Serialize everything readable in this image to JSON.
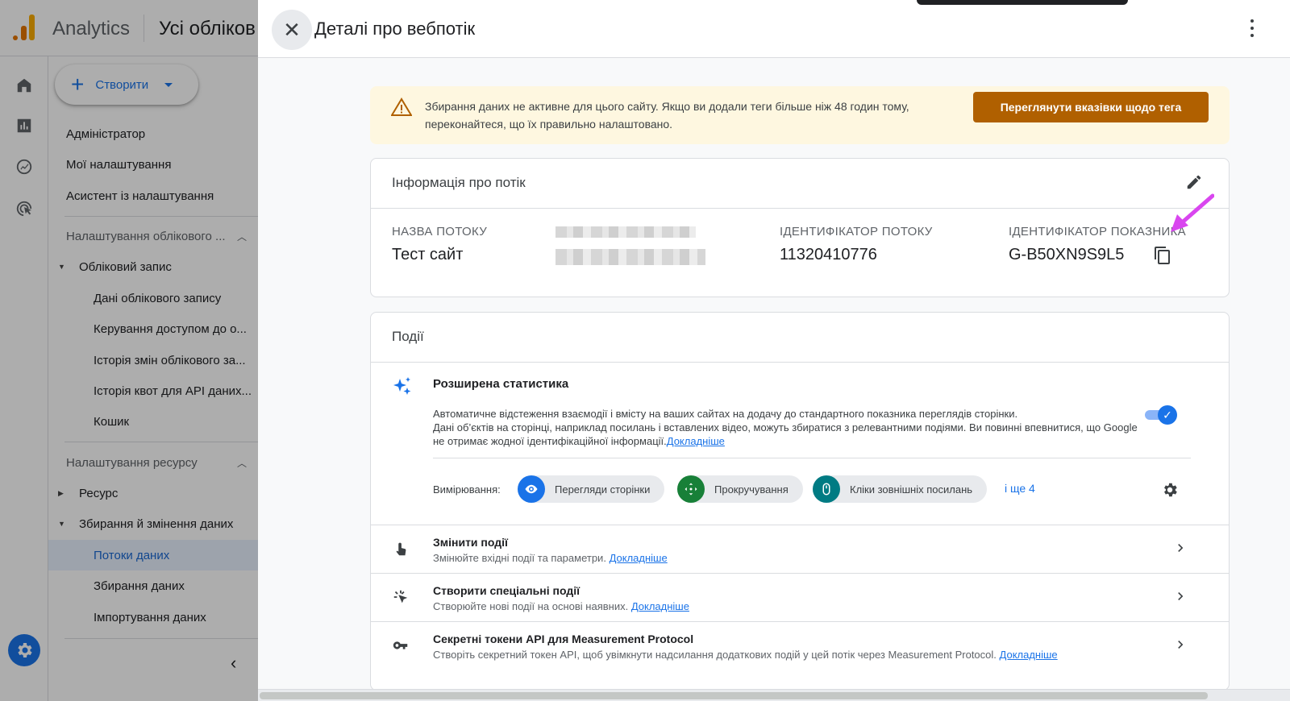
{
  "app": {
    "name": "Analytics",
    "account_title": "Усі обліков"
  },
  "nav": {
    "create_label": "Створити",
    "items": [
      {
        "label": "Адміністратор"
      },
      {
        "label": "Мої налаштування"
      },
      {
        "label": "Асистент із налаштування"
      },
      {
        "label": "Налаштування облікового ..."
      },
      {
        "label": "Обліковий запис"
      },
      {
        "label": "Дані облікового запису"
      },
      {
        "label": "Керування доступом до о..."
      },
      {
        "label": "Історія змін облікового за..."
      },
      {
        "label": "Історія квот для API даних..."
      },
      {
        "label": "Кошик"
      },
      {
        "label": "Налаштування ресурсу"
      },
      {
        "label": "Ресурс"
      },
      {
        "label": "Збирання й змінення даних"
      },
      {
        "label": "Потоки даних"
      },
      {
        "label": "Збирання даних"
      },
      {
        "label": "Імпортування даних"
      }
    ]
  },
  "panel": {
    "title": "Деталі про вебпотік",
    "banner": {
      "text": "Збирання даних не активне для цього сайту. Якщо ви додали теги більше ніж 48 годин тому, переконайтеся, що їх правильно налаштовано.",
      "button": "Переглянути вказівки щодо тега"
    },
    "stream_info": {
      "title": "Інформація про потік",
      "name_label": "НАЗВА ПОТОКУ",
      "name_value": "Тест сайт",
      "id_label": "ІДЕНТИФІКАТОР ПОТОКУ",
      "id_value": "11320410776",
      "measurement_label": "ІДЕНТИФІКАТОР ПОКАЗНИКА",
      "measurement_value": "G-B50XN9S9L5"
    },
    "events": {
      "title": "Події",
      "enhanced": {
        "title": "Розширена статистика",
        "desc_line1": "Автоматичне відстеження взаємодії і вмісту на ваших сайтах на додачу до стандартного показника переглядів сторінки.",
        "desc_line2": "Дані об’єктів на сторінці, наприклад посилань і вставлених відео, можуть збиратися з релевантними подіями. Ви повинні впевнитися, що Google не отримає жодної ідентифікаційної інформації.",
        "learn_more": "Докладніше",
        "toggle_on": true
      },
      "measuring_label": "Вимірювання:",
      "chips": [
        {
          "label": "Перегляди сторінки",
          "color": "#1a73e8",
          "icon": "eye-icon"
        },
        {
          "label": "Прокручування",
          "color": "#188038",
          "icon": "scroll-icon"
        },
        {
          "label": "Кліки зовнішніх посилань",
          "color": "#007b83",
          "icon": "mouse-icon"
        }
      ],
      "more": "і ще 4",
      "rows": [
        {
          "title": "Змінити події",
          "sub": "Змінюйте вхідні події та параметри.",
          "link": "Докладніше",
          "icon": "touch-icon"
        },
        {
          "title": "Створити спеціальні події",
          "sub": "Створюйте нові події на основі наявних.",
          "link": "Докладніше",
          "icon": "click-sparkle-icon"
        },
        {
          "title": "Секретні токени API для Measurement Protocol",
          "sub": "Створіть секретний токен API, щоб увімкнути надсилання додаткових подій у цей потік через Measurement Protocol.",
          "link": "Докладніше",
          "icon": "key-icon"
        }
      ]
    }
  },
  "colors": {
    "accent": "#1a73e8",
    "warning_bg": "#fef7e0",
    "warning_button": "#b06000",
    "annotation_arrow": "#d946ef"
  }
}
